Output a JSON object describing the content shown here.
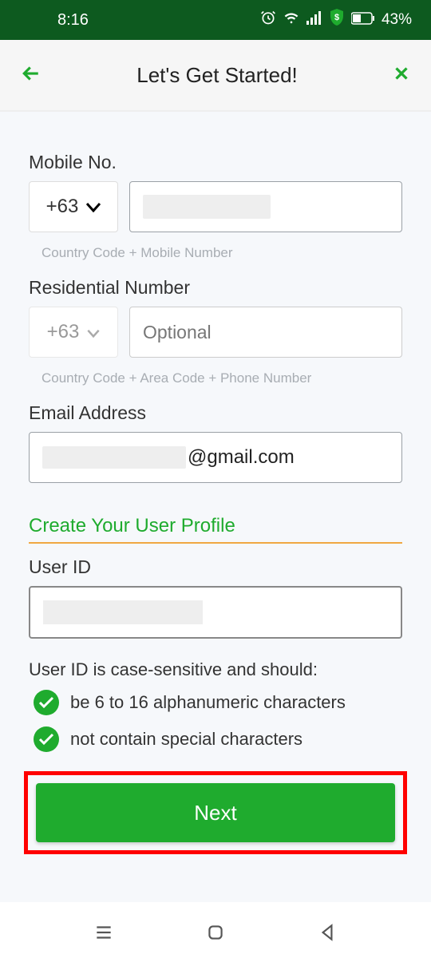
{
  "statusbar": {
    "time": "8:16",
    "battery": "43%"
  },
  "header": {
    "title": "Let's Get Started!"
  },
  "mobile": {
    "label": "Mobile No.",
    "code": "+63",
    "hint": "Country Code + Mobile Number"
  },
  "residential": {
    "label": "Residential Number",
    "code": "+63",
    "placeholder": "Optional",
    "hint": "Country Code + Area Code + Phone Number"
  },
  "email": {
    "label": "Email Address",
    "domain": "@gmail.com"
  },
  "profile": {
    "section": "Create Your User Profile",
    "userid_label": "User ID",
    "rules_title": "User ID is case-sensitive and should:",
    "rule1": "be 6 to 16 alphanumeric characters",
    "rule2": "not contain special characters"
  },
  "buttons": {
    "next": "Next"
  }
}
